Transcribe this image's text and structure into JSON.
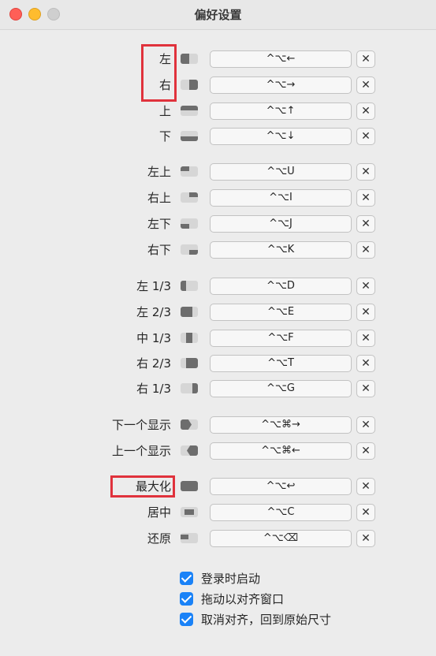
{
  "window": {
    "title": "偏好设置"
  },
  "rows": [
    {
      "id": "left",
      "label": "左",
      "shortcut": "^⌥←",
      "clear": "✕",
      "icon": "window-left-half-icon"
    },
    {
      "id": "right",
      "label": "右",
      "shortcut": "^⌥→",
      "clear": "✕",
      "icon": "window-right-half-icon"
    },
    {
      "id": "top",
      "label": "上",
      "shortcut": "^⌥↑",
      "clear": "✕",
      "icon": "window-top-half-icon"
    },
    {
      "id": "bottom",
      "label": "下",
      "shortcut": "^⌥↓",
      "clear": "✕",
      "icon": "window-bottom-half-icon"
    },
    {
      "id": "top-left",
      "label": "左上",
      "shortcut": "^⌥U",
      "clear": "✕",
      "icon": "window-top-left-icon"
    },
    {
      "id": "top-right",
      "label": "右上",
      "shortcut": "^⌥I",
      "clear": "✕",
      "icon": "window-top-right-icon"
    },
    {
      "id": "bottom-left",
      "label": "左下",
      "shortcut": "^⌥J",
      "clear": "✕",
      "icon": "window-bottom-left-icon"
    },
    {
      "id": "bottom-right",
      "label": "右下",
      "shortcut": "^⌥K",
      "clear": "✕",
      "icon": "window-bottom-right-icon"
    },
    {
      "id": "left-third",
      "label": "左 1/3",
      "shortcut": "^⌥D",
      "clear": "✕",
      "icon": "window-left-third-icon"
    },
    {
      "id": "left-two-thirds",
      "label": "左 2/3",
      "shortcut": "^⌥E",
      "clear": "✕",
      "icon": "window-left-two-thirds-icon"
    },
    {
      "id": "center-third",
      "label": "中 1/3",
      "shortcut": "^⌥F",
      "clear": "✕",
      "icon": "window-center-third-icon"
    },
    {
      "id": "right-two-thirds",
      "label": "右 2/3",
      "shortcut": "^⌥T",
      "clear": "✕",
      "icon": "window-right-two-thirds-icon"
    },
    {
      "id": "right-third",
      "label": "右 1/3",
      "shortcut": "^⌥G",
      "clear": "✕",
      "icon": "window-right-third-icon"
    },
    {
      "id": "next-display",
      "label": "下一个显示",
      "shortcut": "^⌥⌘→",
      "clear": "✕",
      "icon": "next-display-icon"
    },
    {
      "id": "prev-display",
      "label": "上一个显示",
      "shortcut": "^⌥⌘←",
      "clear": "✕",
      "icon": "previous-display-icon"
    },
    {
      "id": "maximize",
      "label": "最大化",
      "shortcut": "^⌥↩",
      "clear": "✕",
      "icon": "window-maximize-icon"
    },
    {
      "id": "center",
      "label": "居中",
      "shortcut": "^⌥C",
      "clear": "✕",
      "icon": "window-center-icon"
    },
    {
      "id": "restore",
      "label": "还原",
      "shortcut": "^⌥⌫",
      "clear": "✕",
      "icon": "window-restore-icon"
    }
  ],
  "options": [
    {
      "label": "登录时启动",
      "checked": true
    },
    {
      "label": "拖动以对齐窗口",
      "checked": true
    },
    {
      "label": "取消对齐，回到原始尺寸",
      "checked": true
    }
  ],
  "colors": {
    "highlight": "#e0323c",
    "checkbox": "#1a82f7",
    "close": "#ff5f57",
    "minimize": "#febc2e"
  }
}
